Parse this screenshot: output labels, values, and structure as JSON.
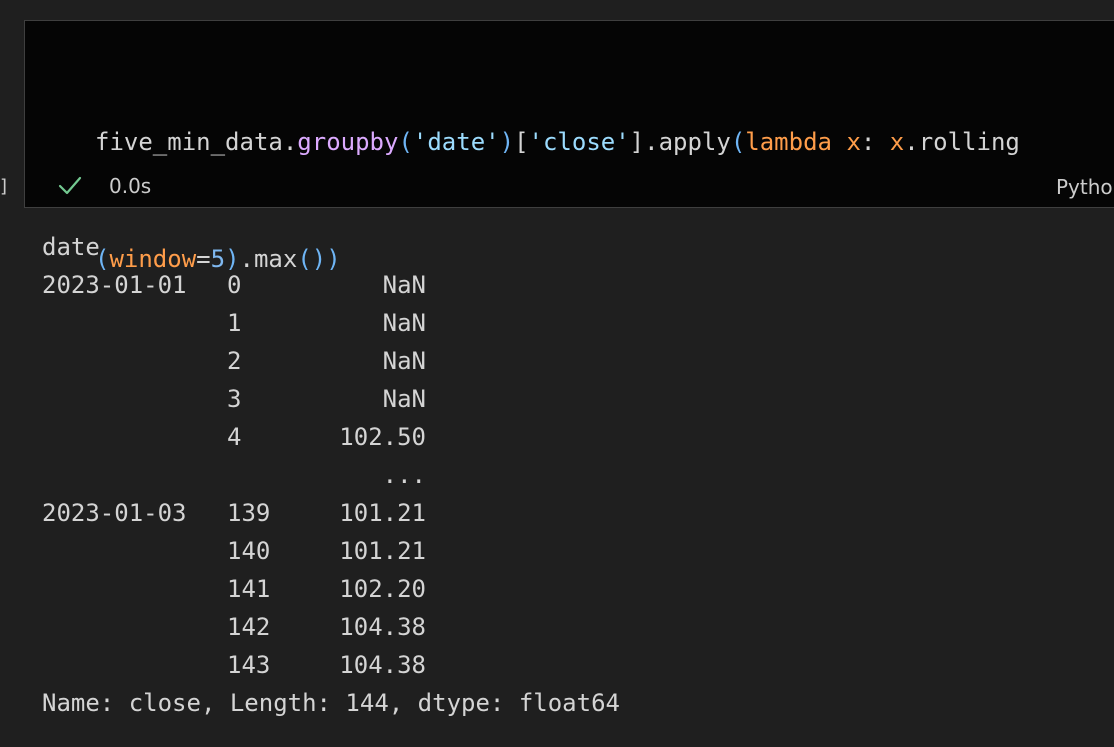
{
  "cell": {
    "exec_bracket": "]",
    "code_tokens_line1": [
      {
        "text": "five_min_data",
        "kind": "ident"
      },
      {
        "text": ".",
        "kind": "punct"
      },
      {
        "text": "groupby",
        "kind": "method"
      },
      {
        "text": "(",
        "kind": "paren"
      },
      {
        "text": "'date'",
        "kind": "string"
      },
      {
        "text": ")",
        "kind": "paren"
      },
      {
        "text": "[",
        "kind": "bracket"
      },
      {
        "text": "'close'",
        "kind": "string"
      },
      {
        "text": "]",
        "kind": "bracket"
      },
      {
        "text": ".",
        "kind": "punct"
      },
      {
        "text": "apply",
        "kind": "ident"
      },
      {
        "text": "(",
        "kind": "paren"
      },
      {
        "text": "lambda",
        "kind": "keyword"
      },
      {
        "text": " ",
        "kind": "punct"
      },
      {
        "text": "x",
        "kind": "param"
      },
      {
        "text": ": ",
        "kind": "punct"
      },
      {
        "text": "x",
        "kind": "param"
      },
      {
        "text": ".rolling",
        "kind": "ident"
      }
    ],
    "code_tokens_line2": [
      {
        "text": "(",
        "kind": "paren"
      },
      {
        "text": "window",
        "kind": "param"
      },
      {
        "text": "=",
        "kind": "punct"
      },
      {
        "text": "5",
        "kind": "number"
      },
      {
        "text": ")",
        "kind": "paren"
      },
      {
        "text": ".max",
        "kind": "ident"
      },
      {
        "text": "()",
        "kind": "paren"
      },
      {
        "text": ")",
        "kind": "paren"
      }
    ],
    "status_icon": "check-icon",
    "status_time": "0.0s",
    "kernel_label": "Python",
    "colors": {
      "cell_background": "#050505",
      "check": "#73c991",
      "method": "#dcaaff",
      "keyword": "#ff9d4a",
      "string": "#9cdcfe",
      "paren": "#6fb5f5"
    }
  },
  "output": {
    "header": "date",
    "rows": [
      {
        "date": "2023-01-01",
        "index": "0",
        "value": "NaN"
      },
      {
        "date": "",
        "index": "1",
        "value": "NaN"
      },
      {
        "date": "",
        "index": "2",
        "value": "NaN"
      },
      {
        "date": "",
        "index": "3",
        "value": "NaN"
      },
      {
        "date": "",
        "index": "4",
        "value": "102.50"
      },
      {
        "date": "",
        "index": "",
        "value": "..."
      },
      {
        "date": "2023-01-03",
        "index": "139",
        "value": "101.21"
      },
      {
        "date": "",
        "index": "140",
        "value": "101.21"
      },
      {
        "date": "",
        "index": "141",
        "value": "102.20"
      },
      {
        "date": "",
        "index": "142",
        "value": "104.38"
      },
      {
        "date": "",
        "index": "143",
        "value": "104.38"
      }
    ],
    "footer": "Name: close, Length: 144, dtype: float64"
  }
}
